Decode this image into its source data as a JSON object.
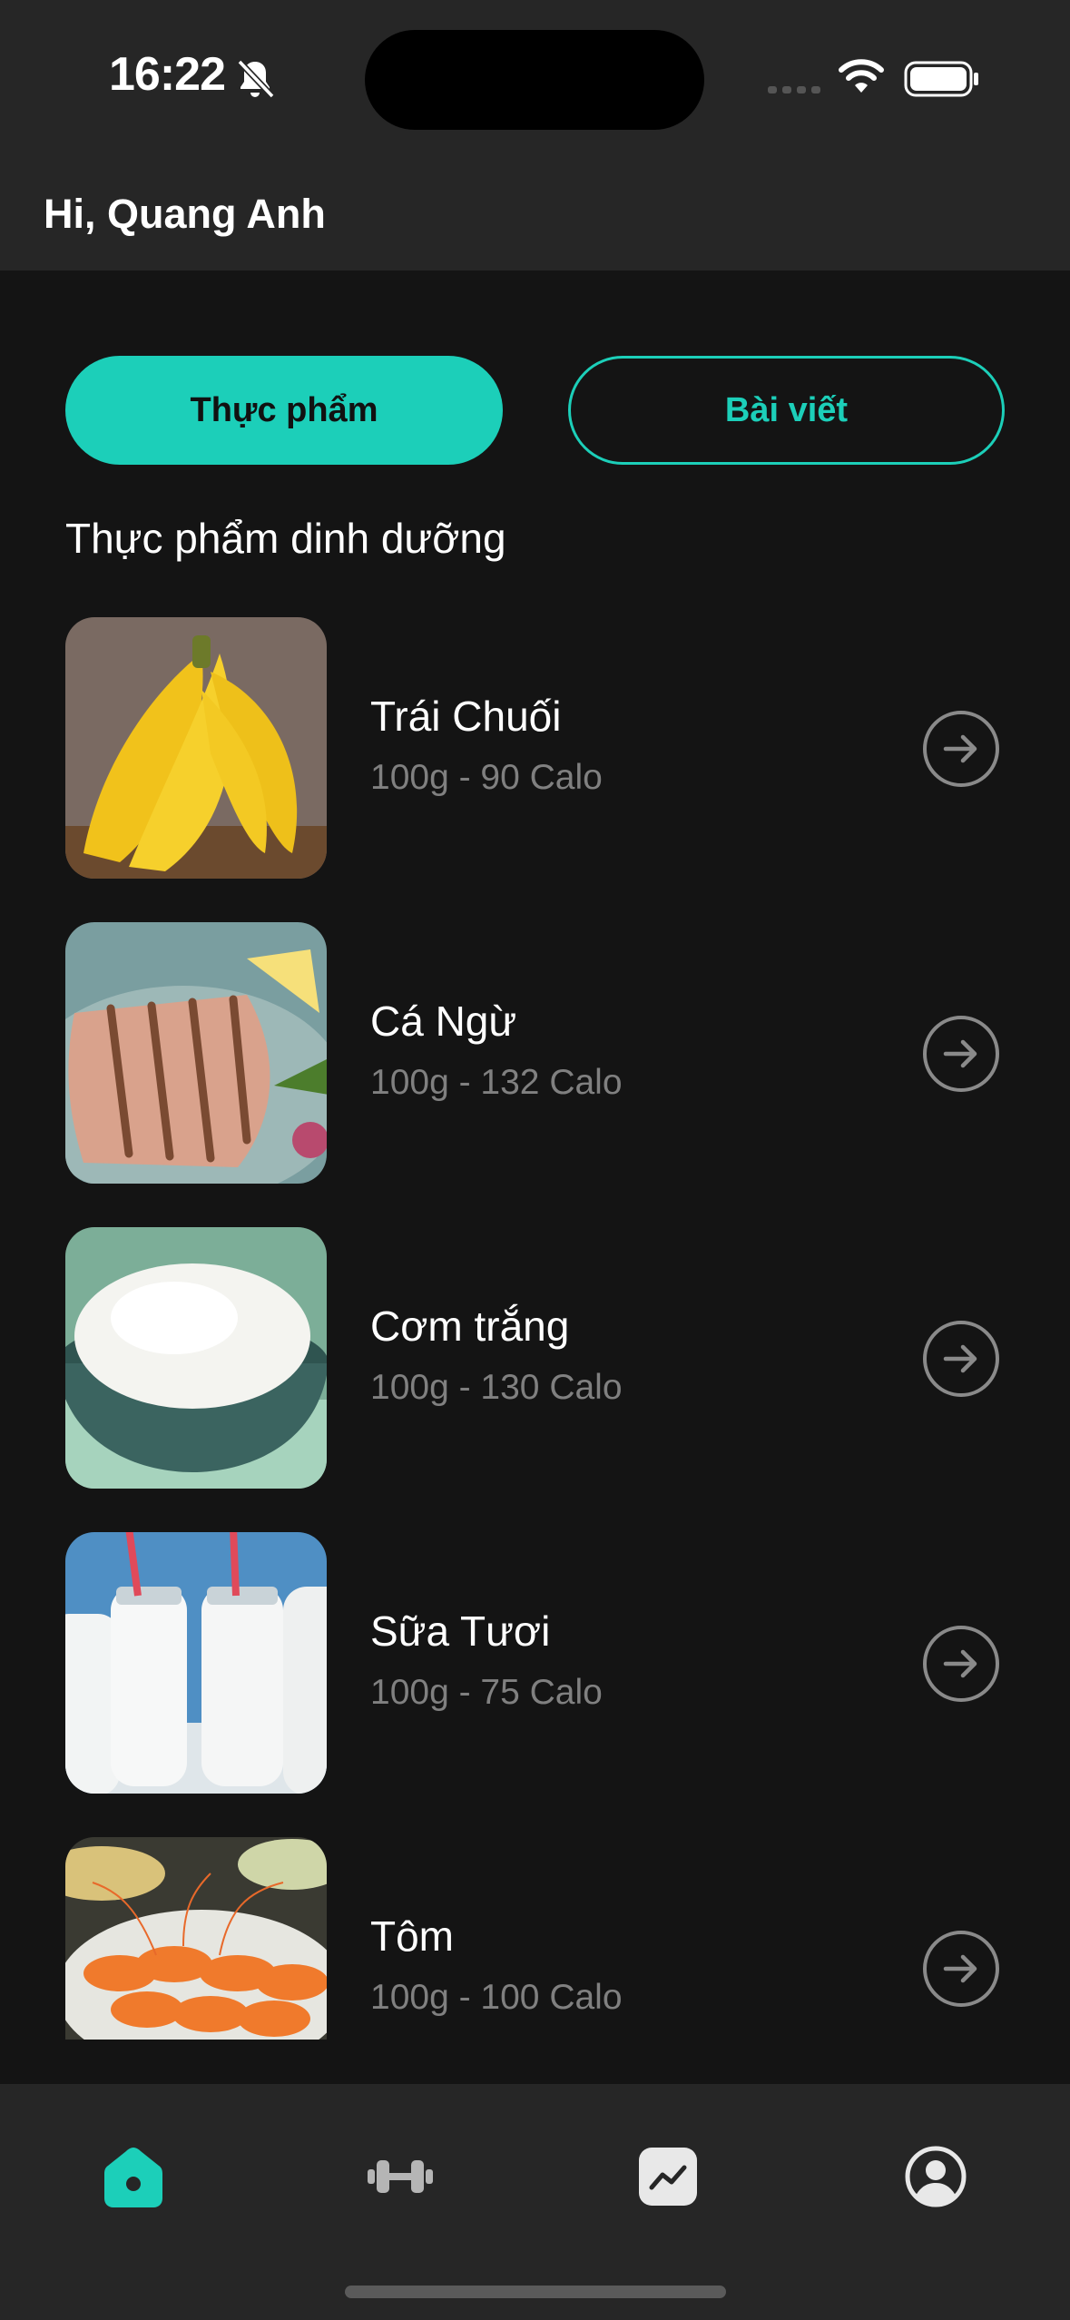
{
  "status_bar": {
    "time": "16:22",
    "icons": [
      "bell-slash-icon",
      "cellular-signal-icon",
      "wifi-icon",
      "battery-icon"
    ]
  },
  "header": {
    "greeting": "Hi, Quang Anh"
  },
  "tabs": [
    {
      "label": "Thực phẩm",
      "active": true
    },
    {
      "label": "Bài viết",
      "active": false
    }
  ],
  "section": {
    "title": "Thực phẩm dinh dưỡng"
  },
  "foods": [
    {
      "name": "Trái Chuối",
      "info": "100g - 90 Calo",
      "image": "banana"
    },
    {
      "name": "Cá Ngừ",
      "info": "100g - 132 Calo",
      "image": "grilled-tuna"
    },
    {
      "name": "Cơm trắng",
      "info": "100g - 130 Calo",
      "image": "white-rice"
    },
    {
      "name": "Sữa Tươi",
      "info": "100g - 75 Calo",
      "image": "milk-bottles"
    },
    {
      "name": "Tôm",
      "info": "100g - 100 Calo",
      "image": "shrimp"
    }
  ],
  "bottom_nav": [
    {
      "icon": "home-icon",
      "active": true
    },
    {
      "icon": "dumbbell-icon",
      "active": false
    },
    {
      "icon": "chart-icon",
      "active": false
    },
    {
      "icon": "profile-icon",
      "active": false
    }
  ],
  "colors": {
    "accent": "#1ccfb9",
    "background": "#141414",
    "surface": "#262626",
    "muted_text": "#808080"
  }
}
